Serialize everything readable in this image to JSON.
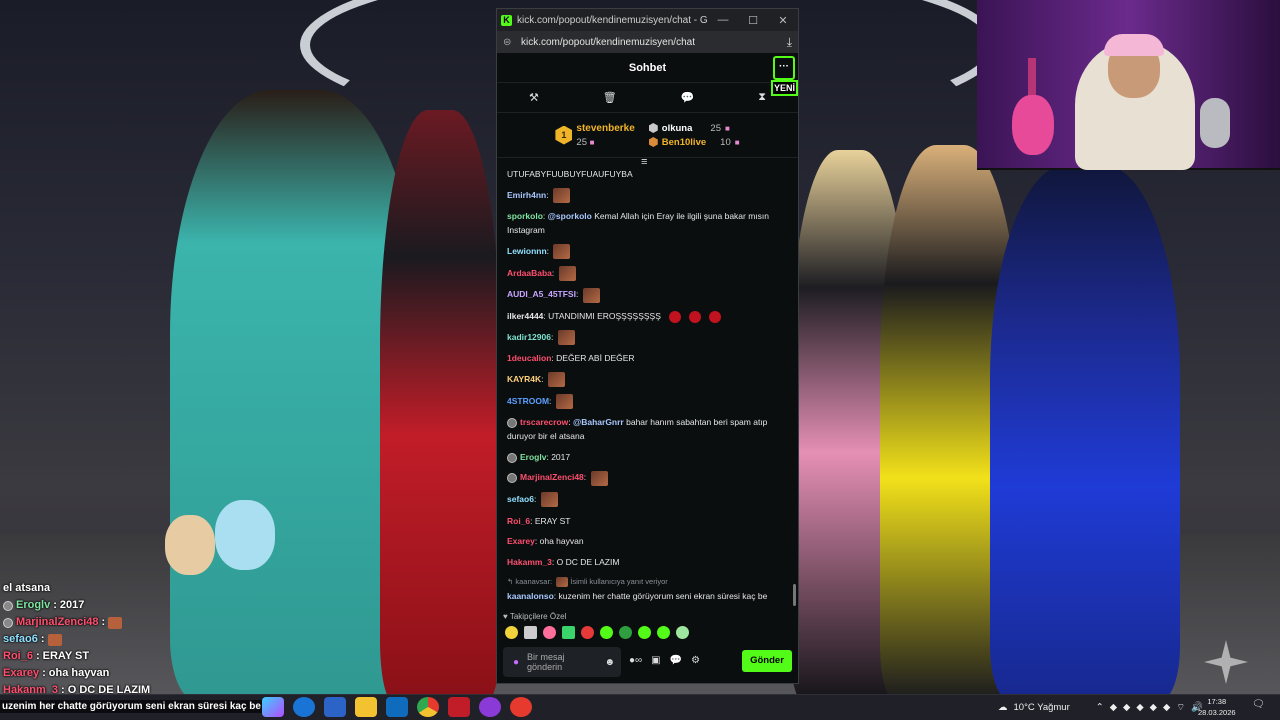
{
  "window": {
    "title": "kick.com/popout/kendinemuzisyen/chat - Google Ch...",
    "url": "kick.com/popout/kendinemuzisyen/chat"
  },
  "chat": {
    "header": "Sohbet",
    "more_label": "···",
    "new_label": "YENİ",
    "leaderboard": {
      "first": {
        "rank": "1",
        "name": "stevenberke",
        "count": "25"
      },
      "second": {
        "name": "olkuna",
        "count": "25"
      },
      "third": {
        "name": "Ben10live",
        "count": "10"
      }
    },
    "messages": [
      {
        "user": "",
        "text": "UTUFABYFUUBUYFUAUFUYBA",
        "color": "#e6e6e6",
        "emote": false
      },
      {
        "user": "Emirh4nn",
        "text": "",
        "color": "#a9c8ff",
        "emote": true
      },
      {
        "user": "sporkolo",
        "text": "Kemal Allah için Eray ile ilgili şuna bakar mısın Instagram",
        "mention": "@sporkolo",
        "color": "#7fe3a0",
        "emote": false
      },
      {
        "user": "Lewionnn",
        "text": "",
        "color": "#8fe0ff",
        "emote": true
      },
      {
        "user": "ArdaaBaba",
        "text": "",
        "color": "#ff4f6f",
        "emote": true
      },
      {
        "user": "AUDI_A5_45TFSI",
        "text": "",
        "color": "#c7a6ff",
        "emote": true
      },
      {
        "user": "ilker4444",
        "text": "UTANDINMI EROŞŞŞŞŞŞŞŞ",
        "color": "#e6e6e6",
        "emote": false,
        "red_emotes": 3
      },
      {
        "user": "kadir12906",
        "text": "",
        "color": "#7fe3d0",
        "emote": true
      },
      {
        "user": "1deucalion",
        "text": "DEĞER ABİ DEĞER",
        "color": "#ff4f6f",
        "emote": false
      },
      {
        "user": "KAYR4K",
        "text": "",
        "color": "#ffd27f",
        "emote": true
      },
      {
        "user": "4STROOM",
        "text": "",
        "color": "#5aa0ff",
        "emote": true
      },
      {
        "user": "trscarecrow",
        "text": "bahar hanım sabahtan beri spam atıp duruyor bir el atsana",
        "mention": "@BaharGnrr",
        "color": "#ff4f6f",
        "badge": true,
        "emote": false
      },
      {
        "user": "Eroglv",
        "text": "2017",
        "color": "#7fe3a0",
        "badge": true,
        "emote": false
      },
      {
        "user": "MarjinalZenci48",
        "text": "",
        "color": "#ff4f6f",
        "badge": true,
        "emote": true
      },
      {
        "user": "sefao6",
        "text": "",
        "color": "#8fe0ff",
        "emote": true
      },
      {
        "user": "Roi_6",
        "text": "ERAY ST",
        "color": "#ff4f6f",
        "emote": false
      },
      {
        "user": "Exarey",
        "text": "oha hayvan",
        "color": "#ff4f6f",
        "emote": false
      },
      {
        "user": "Hakamm_3",
        "text": "O DC DE LAZIM",
        "color": "#ff4f6f",
        "emote": false
      }
    ],
    "reply": {
      "context_user": "kaanavsar:",
      "context_text": "İsimli kullanıcıya yanıt veriyor",
      "user": "kaanalonso",
      "text": "kuzenim her chatte görüyorum seni ekran süresi kaç be"
    },
    "followers_only": "Takipçilere Özel",
    "input_placeholder": "Bir mesaj gönderin",
    "send_label": "Gönder"
  },
  "overlay_chat": [
    {
      "user": "",
      "text": "el atsana"
    },
    {
      "user": "Eroglv",
      "text": "2017",
      "badge": true
    },
    {
      "user": "MarjinalZenci48",
      "text": "",
      "badge": true,
      "emote": true
    },
    {
      "user": "sefao6",
      "text": "",
      "emote": true
    },
    {
      "user": "Roi_6",
      "text": "ERAY ST"
    },
    {
      "user": "Exarey",
      "text": "oha hayvan"
    },
    {
      "user": "Hakanm_3",
      "text": "O DC DE LAZIM"
    }
  ],
  "taskbar": {
    "ticker": "uzenim her chatte görüyorum seni ekran süresi kaç be",
    "weather": "10°C  Yağmur",
    "time": "17:38",
    "date": "28.03.2026"
  },
  "colors": {
    "accent": "#53fc18",
    "gold": "#f0b429",
    "red_user": "#ff4f6f"
  }
}
